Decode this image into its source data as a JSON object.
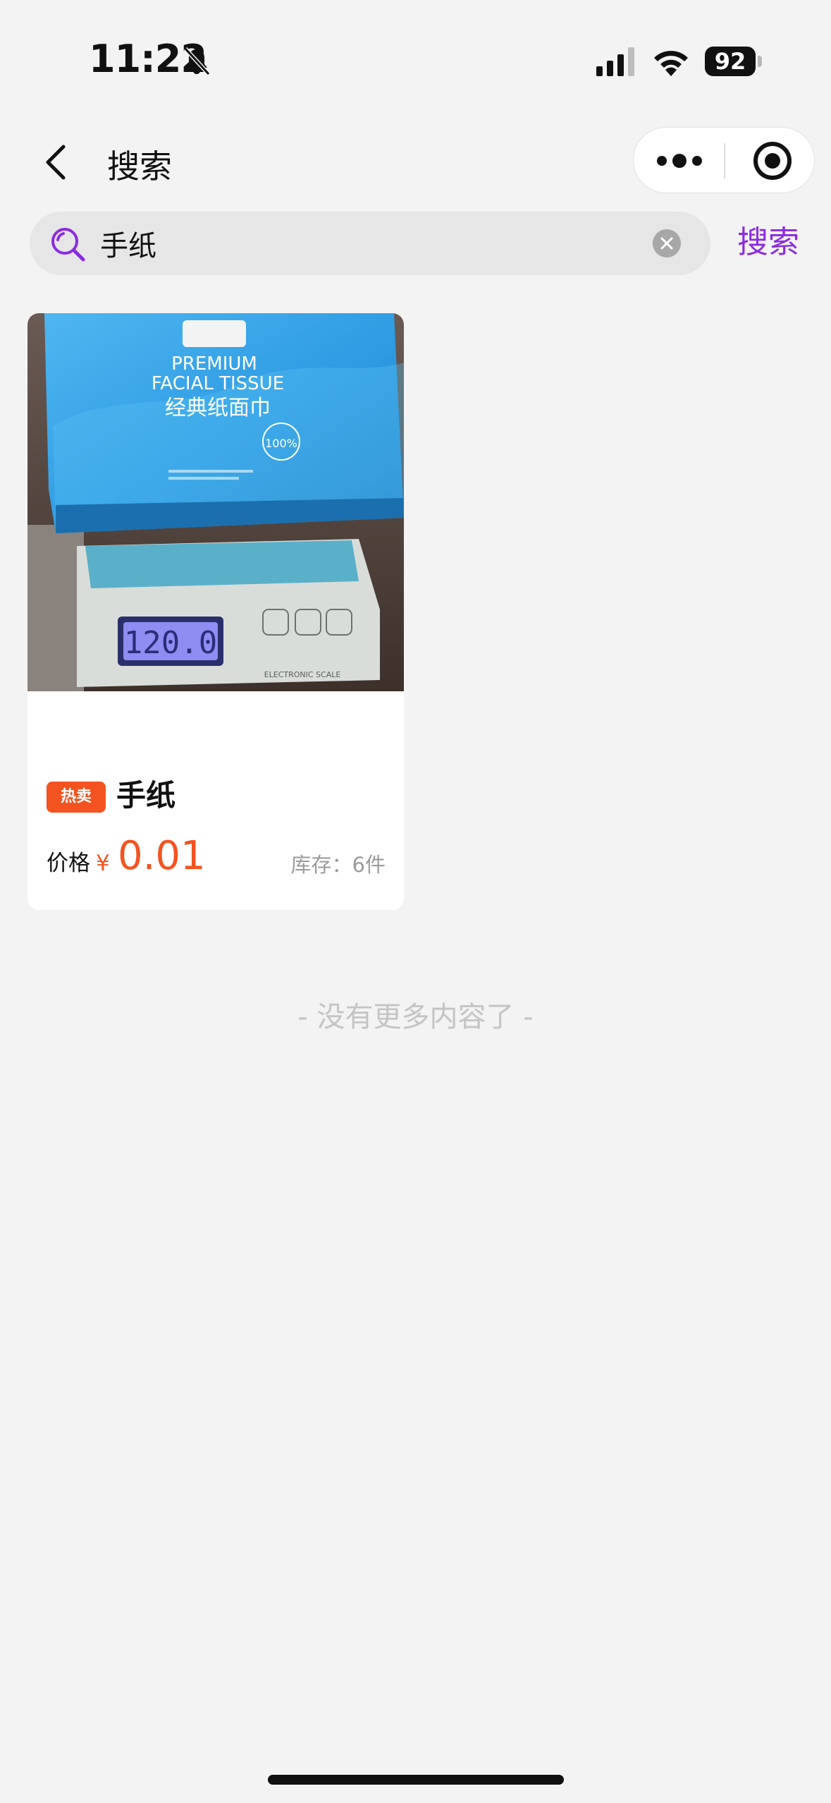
{
  "status_bar": {
    "time": "11:22",
    "battery": "92",
    "icons": [
      "bell-off-icon",
      "signal-icon",
      "wifi-icon",
      "battery-icon"
    ]
  },
  "header": {
    "title": "搜索",
    "icons": [
      "back-icon",
      "more-icon",
      "target-icon"
    ]
  },
  "search": {
    "query": "手纸",
    "button_label": "搜索",
    "accent_color": "#8b2be2",
    "icons": [
      "search-icon",
      "clear-icon"
    ]
  },
  "products": [
    {
      "badge": "热卖",
      "name": "手纸",
      "price_label": "价格",
      "currency": "¥",
      "price": "0.01",
      "stock": "库存：6件",
      "image": {
        "package_text_1": "PREMIUM",
        "package_text_2": "FACIAL TISSUE",
        "package_text_3": "经典纸面巾",
        "package_percent": "100%",
        "scale_display": "120.0",
        "scale_label": "ELECTRONIC SCALE"
      }
    }
  ],
  "footer": {
    "no_more": "- 没有更多内容了 -"
  },
  "colors": {
    "background": "#f3f3f3",
    "price": "#f35320",
    "badge": "#f35320"
  }
}
